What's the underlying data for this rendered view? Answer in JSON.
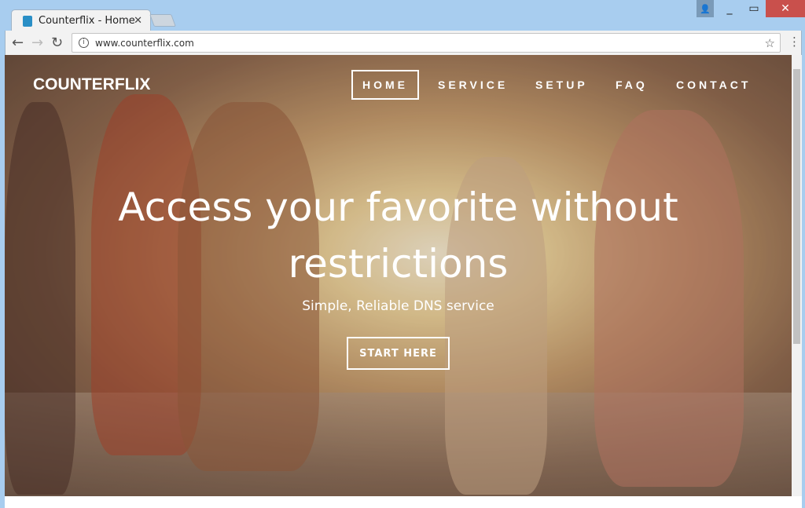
{
  "browser": {
    "tab_title": "Counterflix - Home",
    "url": "www.counterflix.com"
  },
  "site": {
    "brand": "COUNTERFLIX",
    "nav": [
      {
        "label": "HOME",
        "active": true
      },
      {
        "label": "SERVICE"
      },
      {
        "label": "SETUP"
      },
      {
        "label": "FAQ"
      },
      {
        "label": "CONTACT"
      }
    ],
    "headline": "Access your favorite without restrictions",
    "subheadline": "Simple, Reliable DNS service",
    "cta": "START HERE"
  },
  "colors": {
    "close_button": "#c9504c",
    "titlebar": "#a8cdef"
  }
}
